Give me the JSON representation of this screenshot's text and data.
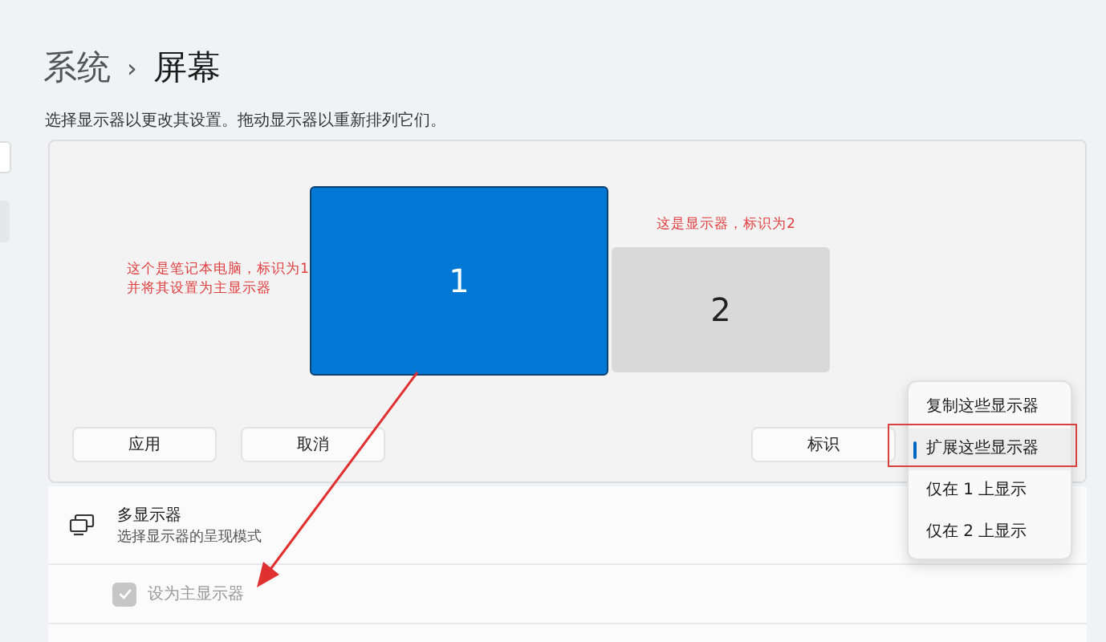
{
  "breadcrumb": {
    "parent": "系统",
    "separator": "›",
    "current": "屏幕"
  },
  "description": "选择显示器以更改其设置。拖动显示器以重新排列它们。",
  "displays": [
    {
      "label": "1",
      "selected": true
    },
    {
      "label": "2",
      "selected": false
    }
  ],
  "notes": [
    "这个是笔记本电脑，标识为1\n并将其设置为主显示器",
    "这是显示器，标识为2"
  ],
  "buttons": [
    "应用",
    "取消",
    "标识"
  ],
  "menu": {
    "items": [
      {
        "label": "复制这些显示器",
        "selected": false
      },
      {
        "label": "扩展这些显示器",
        "selected": true
      },
      {
        "label": "仅在 1 上显示",
        "selected": false
      },
      {
        "label": "仅在 2 上显示",
        "selected": false
      }
    ]
  },
  "multi_display": {
    "title": "多显示器",
    "subtitle": "选择显示器的呈现模式"
  },
  "primary_checkbox": {
    "label": "设为主显示器",
    "checked": true,
    "disabled": true
  }
}
